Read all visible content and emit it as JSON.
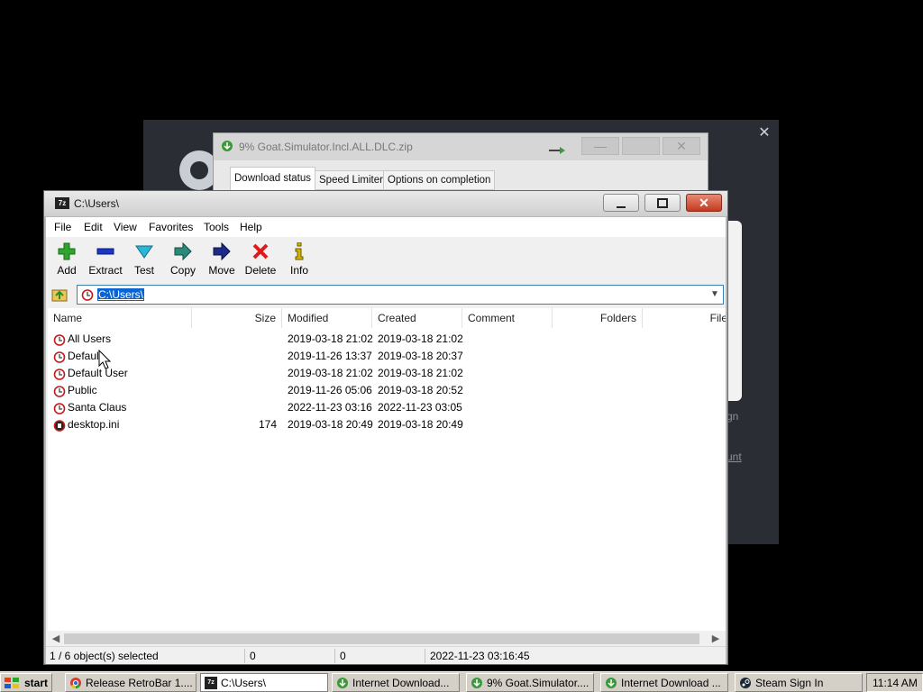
{
  "steam": {
    "close_glyph": "✕",
    "sign_text": "gn",
    "account_text": "unt"
  },
  "idm": {
    "title": "9% Goat.Simulator.Incl.ALL.DLC.zip",
    "tabs": [
      "Download status",
      "Speed Limiter",
      "Options on completion"
    ]
  },
  "zip": {
    "title": "C:\\Users\\",
    "title_icon": "7z",
    "menu": [
      "File",
      "Edit",
      "View",
      "Favorites",
      "Tools",
      "Help"
    ],
    "toolbar": [
      {
        "label": "Add",
        "icon": "plus-icon",
        "color": "#2ea52e"
      },
      {
        "label": "Extract",
        "icon": "minus-icon",
        "color": "#1a36c8"
      },
      {
        "label": "Test",
        "icon": "check-icon",
        "color": "#2ab6d6"
      },
      {
        "label": "Copy",
        "icon": "copy-arrow-icon",
        "color": "#2a8a7a"
      },
      {
        "label": "Move",
        "icon": "move-arrow-icon",
        "color": "#1c2a8a"
      },
      {
        "label": "Delete",
        "icon": "delete-x-icon",
        "color": "#e01a1a"
      },
      {
        "label": "Info",
        "icon": "info-icon",
        "color": "#d6b400"
      }
    ],
    "address": "C:\\Users\\",
    "columns": [
      "Name",
      "Size",
      "Modified",
      "Created",
      "Comment",
      "Folders",
      "File"
    ],
    "rows": [
      {
        "name": "All Users",
        "size": "",
        "modified": "2019-03-18 21:02",
        "created": "2019-03-18 21:02",
        "icon": "folder-link-icon"
      },
      {
        "name": "Default",
        "size": "",
        "modified": "2019-11-26 13:37",
        "created": "2019-03-18 20:37",
        "icon": "folder-link-icon"
      },
      {
        "name": "Default User",
        "size": "",
        "modified": "2019-03-18 21:02",
        "created": "2019-03-18 21:02",
        "icon": "folder-link-icon"
      },
      {
        "name": "Public",
        "size": "",
        "modified": "2019-11-26 05:06",
        "created": "2019-03-18 20:52",
        "icon": "folder-link-icon"
      },
      {
        "name": "Santa Claus",
        "size": "",
        "modified": "2022-11-23 03:16",
        "created": "2022-11-23 03:05",
        "icon": "folder-link-icon"
      },
      {
        "name": "desktop.ini",
        "size": "174",
        "modified": "2019-03-18 20:49",
        "created": "2019-03-18 20:49",
        "icon": "file-icon"
      }
    ],
    "status": {
      "selected": "1 / 6 object(s) selected",
      "size": "0",
      "packed": "0",
      "modified": "2022-11-23 03:16:45"
    }
  },
  "taskbar": {
    "start_label": "start",
    "items": [
      {
        "label": "Release RetroBar 1....",
        "icon": "chrome-icon",
        "active": false
      },
      {
        "label": "C:\\Users\\",
        "icon": "7zip-icon",
        "active": true
      },
      {
        "label": "Internet Download...",
        "icon": "idm-icon",
        "active": false
      },
      {
        "label": "9% Goat.Simulator....",
        "icon": "idm-icon",
        "active": false
      },
      {
        "label": "Internet Download ...",
        "icon": "idm-icon",
        "active": false
      },
      {
        "label": "Steam Sign In",
        "icon": "steam-icon",
        "active": false
      }
    ],
    "clock": "11:14 AM"
  }
}
